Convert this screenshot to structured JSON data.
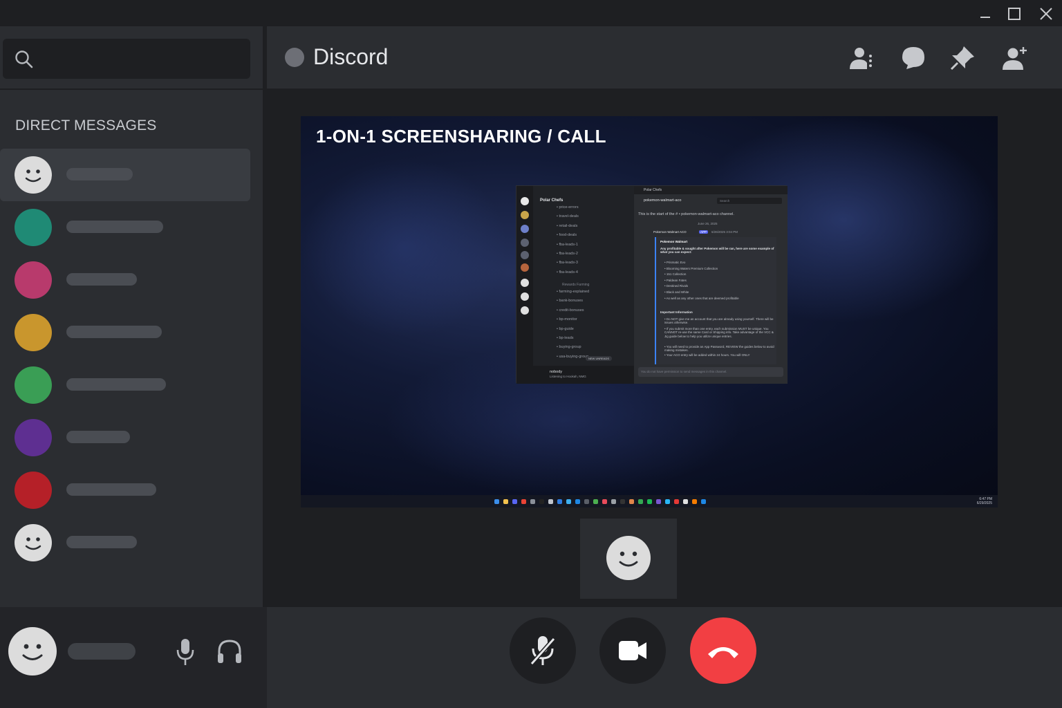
{
  "window": {
    "minimize_icon": "minimize-icon",
    "maximize_icon": "maximize-icon",
    "close_icon": "close-icon"
  },
  "sidebar": {
    "search_icon": "search-icon",
    "section_title": "DIRECT MESSAGES",
    "dms": [
      {
        "avatar_color": "#dcdcdc",
        "avatar_type": "smiley",
        "active": true
      },
      {
        "avatar_color": "#1f8a75",
        "avatar_type": "solid"
      },
      {
        "avatar_color": "#b83a6c",
        "avatar_type": "solid"
      },
      {
        "avatar_color": "#c9962d",
        "avatar_type": "solid"
      },
      {
        "avatar_color": "#3a9e55",
        "avatar_type": "solid"
      },
      {
        "avatar_color": "#5e2f91",
        "avatar_type": "solid"
      },
      {
        "avatar_color": "#b52028",
        "avatar_type": "solid"
      },
      {
        "avatar_color": "#dcdcdc",
        "avatar_type": "smiley"
      }
    ]
  },
  "user_panel": {
    "mic_icon": "microphone-icon",
    "headset_icon": "headphones-icon"
  },
  "header": {
    "title": "Discord",
    "icons": [
      "user-settings-icon",
      "chat-bubble-icon",
      "pin-icon",
      "add-friend-icon"
    ]
  },
  "stage": {
    "share_label": "1-ON-1 SCREENSHARING / CALL",
    "shared_screen": {
      "server_name": "Polar Chefs",
      "window_title": "Polar Chefs",
      "channels": [
        "price-errors",
        "travel-deals",
        "retail-deals",
        "food-deals",
        "fba-leads-1",
        "fba-leads-2",
        "fba-leads-3",
        "fba-leads-4"
      ],
      "category": "Rewards Farming",
      "channels2": [
        "farming-explained",
        "bank-bonuses",
        "credit-bonuses",
        "bp-monitor",
        "bp-guide",
        "bp-leads",
        "buying-group",
        "usa-buying-group"
      ],
      "new_unreads": "NEW UNREADS",
      "user_name": "nobody",
      "user_status": "Listening to Hookah, NMG",
      "channel_name": "pokemon-walmart-aco",
      "search": "Search",
      "start_text": "This is the start of the # • pokemon-walmart-aco channel.",
      "date": "June 26, 2025",
      "bot_name": "Pokemon Walmart ACO",
      "bot_tag": "APP",
      "bot_time": "6/26/2025 3:04 PM",
      "embed_title": "Pokemon Walmart",
      "embed_intro": "Any profitable & sought after Pokemon will be ran, here are some example of what you can expect:",
      "embed_items": [
        "Prismatic Evo",
        "Blooming Waters Premium Collection",
        "151 Collection",
        "Paldean Fates",
        "Destined Rivals",
        "Black and White",
        "As well as any other ones that are deemed profitable"
      ],
      "info_title": "Important Information",
      "info_items": [
        "Do NOT give me an account that you are already using yourself. There will be issues otherwise.",
        "If you submit more than one entry, each submission MUST be unique. You CANNOT re-use the same Card or Shipping info. Take advantage of the VCC & Jig guide below to help you utilize unique entries.",
        "You will need to provide an App Password, REVIEW the guides below to avoid making mistakes.",
        "Your ACO entry will be added within 24 hours. You will ONLY"
      ],
      "footer_text": "You do not have permission to send messages in this channel.",
      "clock_time": "6:47 PM",
      "clock_date": "6/29/2025"
    }
  },
  "controls": {
    "mute_icon": "mic-muted-icon",
    "video_icon": "video-camera-icon",
    "hangup_icon": "hang-up-icon",
    "hangup_color": "#f23f43"
  }
}
